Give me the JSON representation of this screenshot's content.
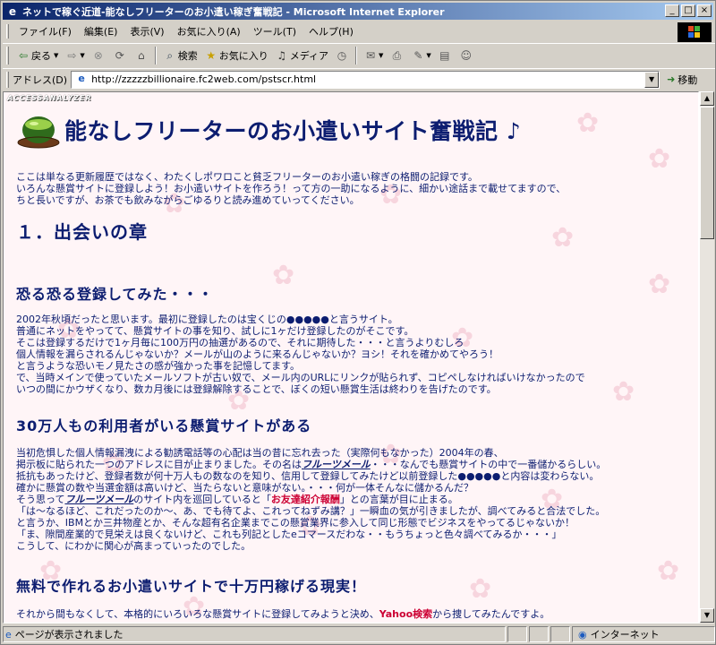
{
  "window": {
    "title": "ネットで稼ぐ近道-能なしフリーターのお小遣い稼ぎ奮戦記 - Microsoft Internet Explorer",
    "min_label": "_",
    "max_label": "□",
    "close_label": "×"
  },
  "menu": [
    "ファイル(F)",
    "編集(E)",
    "表示(V)",
    "お気に入り(A)",
    "ツール(T)",
    "ヘルプ(H)"
  ],
  "toolbar": {
    "back": "戻る",
    "search": "検索",
    "favorites": "お気に入り",
    "media": "メディア"
  },
  "address": {
    "label": "アドレス(D)",
    "url": "http://zzzzzbillionaire.fc2web.com/pstscr.html",
    "go": "移動"
  },
  "page": {
    "analyzer": "ACCESSANALYZER",
    "title": "能なしフリーターのお小遣いサイト奮戦記 ♪",
    "intro": [
      "ここは単なる更新履歴ではなく、わたくしポワロこと貧乏フリーターのお小遣い稼ぎの格闘の記録です。",
      "いろんな懸賞サイトに登録しよう！お小遣いサイトを作ろう！って方の一助になるように、細かい途話まで載せてますので、",
      "ちと長いですが、お茶でも飲みながらごゆるりと読み進めていってください。"
    ],
    "chapter1": "１．出会いの章",
    "section1_title": "恐る恐る登録してみた・・・",
    "section1_lines": [
      "2002年秋頃だったと思います。最初に登録したのは宝くじの●●●●●と言うサイト。",
      "普通にネットをやってて、懸賞サイトの事を知り、試しに1ヶだけ登録したのがそこです。",
      "そこは登録するだけで1ヶ月毎に100万円の抽選があるので、それに期待した・・・と言うよりむしろ",
      "個人情報を漏らされるんじゃないか？メールが山のように来るんじゃないか？ヨシ！それを確かめてやろう！",
      "と言うような恐いモノ見たさの感が強かった事を記憶してます。",
      "で、当時メインで使っていたメールソフトが古い奴で、メール内のURLにリンクが貼られず、コピペしなければいけなかったので",
      "いつの間にかウザくなり、数カ月後には登録解除することで、ぼくの短い懸賞生活は終わりを告げたのです。"
    ],
    "section2_title": "30万人もの利用者がいる懸賞サイトがある",
    "section2": {
      "l1": "当初危惧した個人情報漏洩による勧誘電話等の心配は当の昔に忘れ去った（実際何もなかった）2004年の春、",
      "l2_a": "掲示板に貼られた一つのアドレスに目が止まりました。その名は",
      "l2_link": "フルーツメール",
      "l2_b": "・・・なんでも懸賞サイトの中で一番儲かるらしい。",
      "l3": "抵抗もあったけど、登録者数が何十万人もの数なのを知り、信用して登録してみたけど以前登録した●●●●●と内容は変わらない。",
      "l4": "確かに懸賞の数や当選金額は高いけど、当たらないと意味がない。・・・何が一体そんなに儲かるんだ？",
      "l5_a": "そう思って",
      "l5_link": "フルーツメール",
      "l5_b": "のサイト内を巡回していると「",
      "l5_red": "お友達紹介報酬",
      "l5_c": "」との言葉が目に止まる。",
      "l6": "「は～なるほど、これだったのか～、あ、でも待てよ、これってねずみ講？」一瞬血の気が引きましたが、調べてみると合法でした。",
      "l7": "と言うか、IBMとか三井物産とか、そんな超有名企業までこの懸賞業界に参入して同じ形態でビジネスをやってるじゃないか！",
      "l8": "「ま、隙間産業的で見栄えは良くないけど、これも列記としたeコマースだわな・・もうちょっと色々調べてみるか・・・」",
      "l9": "こうして、にわかに関心が高まっていったのでした。"
    },
    "section3_title": "無料で作れるお小遣いサイトで十万円稼げる現実！",
    "section3": {
      "l1_a": "それから間もなくして、本格的にいろいろな懸賞サイトに登録してみようと決め、",
      "l1_red": "Yahoo検索",
      "l1_b": "から捜してみたんですよ。"
    }
  },
  "status": {
    "text": "ページが表示されました",
    "zone": "インターネット"
  }
}
